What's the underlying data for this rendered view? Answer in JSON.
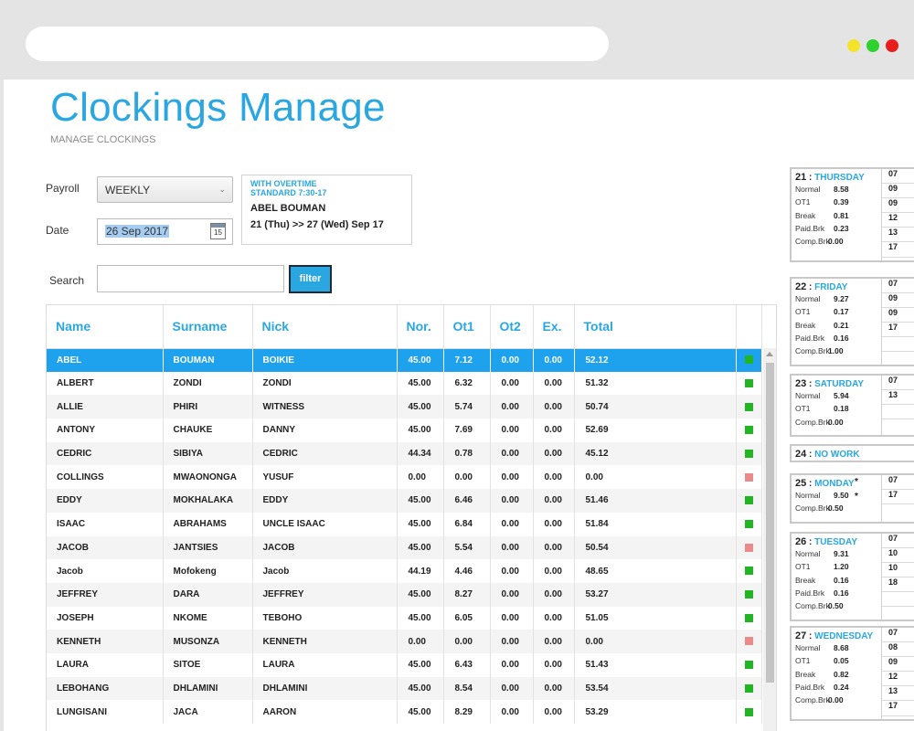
{
  "page": {
    "title": "Clockings Manage",
    "subtitle": "MANAGE CLOCKINGS"
  },
  "filters": {
    "payroll_label": "Payroll",
    "payroll_value": "WEEKLY",
    "date_label": "Date",
    "date_value": "26 Sep 2017",
    "calendar_icon_text": "15",
    "search_label": "Search",
    "search_value": "",
    "filter_button": "filter"
  },
  "info": {
    "line1": "WITH OVERTIME",
    "line2": "STANDARD 7:30-17",
    "employee": "ABEL BOUMAN",
    "period": "21 (Thu) >> 27 (Wed) Sep 17"
  },
  "table": {
    "columns": [
      "Name",
      "Surname",
      "Nick",
      "Nor.",
      "Ot1",
      "Ot2",
      "Ex.",
      "Total"
    ],
    "rows": [
      {
        "name": "ABEL",
        "surname": "BOUMAN",
        "nick": "BOIKIE",
        "nor": "45.00",
        "ot1": "7.12",
        "ot2": "0.00",
        "ex": "0.00",
        "total": "52.12",
        "status": "green"
      },
      {
        "name": "ALBERT",
        "surname": "ZONDI",
        "nick": "ZONDI",
        "nor": "45.00",
        "ot1": "6.32",
        "ot2": "0.00",
        "ex": "0.00",
        "total": "51.32",
        "status": "green"
      },
      {
        "name": "ALLIE",
        "surname": "PHIRI",
        "nick": "WITNESS",
        "nor": "45.00",
        "ot1": "5.74",
        "ot2": "0.00",
        "ex": "0.00",
        "total": "50.74",
        "status": "green"
      },
      {
        "name": "ANTONY",
        "surname": "CHAUKE",
        "nick": "DANNY",
        "nor": "45.00",
        "ot1": "7.69",
        "ot2": "0.00",
        "ex": "0.00",
        "total": "52.69",
        "status": "green"
      },
      {
        "name": "CEDRIC",
        "surname": "SIBIYA",
        "nick": "CEDRIC",
        "nor": "44.34",
        "ot1": "0.78",
        "ot2": "0.00",
        "ex": "0.00",
        "total": "45.12",
        "status": "green"
      },
      {
        "name": "COLLINGS",
        "surname": "MWAONONGA",
        "nick": "YUSUF",
        "nor": "0.00",
        "ot1": "0.00",
        "ot2": "0.00",
        "ex": "0.00",
        "total": "0.00",
        "status": "red"
      },
      {
        "name": "EDDY",
        "surname": "MOKHALAKA",
        "nick": "EDDY",
        "nor": "45.00",
        "ot1": "6.46",
        "ot2": "0.00",
        "ex": "0.00",
        "total": "51.46",
        "status": "green"
      },
      {
        "name": "ISAAC",
        "surname": "ABRAHAMS",
        "nick": "UNCLE ISAAC",
        "nor": "45.00",
        "ot1": "6.84",
        "ot2": "0.00",
        "ex": "0.00",
        "total": "51.84",
        "status": "green"
      },
      {
        "name": "JACOB",
        "surname": "JANTSIES",
        "nick": "JACOB",
        "nor": "45.00",
        "ot1": "5.54",
        "ot2": "0.00",
        "ex": "0.00",
        "total": "50.54",
        "status": "red"
      },
      {
        "name": "Jacob",
        "surname": "Mofokeng",
        "nick": "Jacob",
        "nor": "44.19",
        "ot1": "4.46",
        "ot2": "0.00",
        "ex": "0.00",
        "total": "48.65",
        "status": "green"
      },
      {
        "name": "JEFFREY",
        "surname": "DARA",
        "nick": "JEFFREY",
        "nor": "45.00",
        "ot1": "8.27",
        "ot2": "0.00",
        "ex": "0.00",
        "total": "53.27",
        "status": "green"
      },
      {
        "name": "JOSEPH",
        "surname": "NKOME",
        "nick": "TEBOHO",
        "nor": "45.00",
        "ot1": "6.05",
        "ot2": "0.00",
        "ex": "0.00",
        "total": "51.05",
        "status": "green"
      },
      {
        "name": "KENNETH",
        "surname": "MUSONZA",
        "nick": "KENNETH",
        "nor": "0.00",
        "ot1": "0.00",
        "ot2": "0.00",
        "ex": "0.00",
        "total": "0.00",
        "status": "red"
      },
      {
        "name": "LAURA",
        "surname": "SITOE",
        "nick": "LAURA",
        "nor": "45.00",
        "ot1": "6.43",
        "ot2": "0.00",
        "ex": "0.00",
        "total": "51.43",
        "status": "green"
      },
      {
        "name": "LEBOHANG",
        "surname": "DHLAMINI",
        "nick": "DHLAMINI",
        "nor": "45.00",
        "ot1": "8.54",
        "ot2": "0.00",
        "ex": "0.00",
        "total": "53.54",
        "status": "green"
      },
      {
        "name": "LUNGISANI",
        "surname": "JACA",
        "nick": "AARON",
        "nor": "45.00",
        "ot1": "8.29",
        "ot2": "0.00",
        "ex": "0.00",
        "total": "53.29",
        "status": "green"
      }
    ]
  },
  "days": [
    {
      "num": "21",
      "day": "THURSDAY",
      "stats": [
        {
          "label": "Normal",
          "value": "8.58"
        },
        {
          "label": "OT1",
          "value": "0.39"
        },
        {
          "label": "Break",
          "value": "0.81"
        },
        {
          "label": "Paid.Brk",
          "value": "0.23"
        },
        {
          "label": "Comp.Brk",
          "value": "0.00"
        }
      ],
      "times": [
        {
          "text": "07",
          "star": ""
        },
        {
          "text": "09",
          "star": ""
        },
        {
          "text": "09",
          "star": ""
        },
        {
          "text": "12",
          "star": ""
        },
        {
          "text": "13",
          "star": ""
        },
        {
          "text": "17",
          "star": ""
        }
      ]
    },
    {
      "num": "22",
      "day": "FRIDAY",
      "stats": [
        {
          "label": "Normal",
          "value": "9.27"
        },
        {
          "label": "OT1",
          "value": "0.17"
        },
        {
          "label": "Break",
          "value": "0.21"
        },
        {
          "label": "Paid.Brk",
          "value": "0.16"
        },
        {
          "label": "Comp.Brk",
          "value": "1.00"
        }
      ],
      "times": [
        {
          "text": "07",
          "star": ""
        },
        {
          "text": "09",
          "star": ""
        },
        {
          "text": "09",
          "star": ""
        },
        {
          "text": "17",
          "star": ""
        },
        {
          "text": "",
          "star": ""
        }
      ]
    },
    {
      "num": "23",
      "day": "SATURDAY",
      "stats": [
        {
          "label": "Normal",
          "value": "5.94"
        },
        {
          "label": "OT1",
          "value": "0.18"
        },
        {
          "label": "Comp.Brk",
          "value": "0.00"
        }
      ],
      "times": [
        {
          "text": "07",
          "star": ""
        },
        {
          "text": "13",
          "star": ""
        },
        {
          "text": "",
          "star": ""
        }
      ]
    },
    {
      "num": "24",
      "day": "NO WORK",
      "stats": [],
      "times": []
    },
    {
      "num": "25",
      "day": "MONDAY",
      "stats": [
        {
          "label": "Normal",
          "value": "9.50"
        },
        {
          "label": "Comp.Brk",
          "value": "0.50"
        }
      ],
      "times": [
        {
          "text": "07",
          "star": "*"
        },
        {
          "text": "17",
          "star": "*"
        }
      ]
    },
    {
      "num": "26",
      "day": "TUESDAY",
      "stats": [
        {
          "label": "Normal",
          "value": "9.31"
        },
        {
          "label": "OT1",
          "value": "1.20"
        },
        {
          "label": "Break",
          "value": "0.16"
        },
        {
          "label": "Paid.Brk",
          "value": "0.16"
        },
        {
          "label": "Comp.Brk",
          "value": "0.50"
        }
      ],
      "times": [
        {
          "text": "07",
          "star": ""
        },
        {
          "text": "10",
          "star": ""
        },
        {
          "text": "10",
          "star": ""
        },
        {
          "text": "18",
          "star": ""
        },
        {
          "text": "",
          "star": ""
        }
      ]
    },
    {
      "num": "27",
      "day": "WEDNESDAY",
      "stats": [
        {
          "label": "Normal",
          "value": "8.68"
        },
        {
          "label": "OT1",
          "value": "0.05"
        },
        {
          "label": "Break",
          "value": "0.82"
        },
        {
          "label": "Paid.Brk",
          "value": "0.24"
        },
        {
          "label": "Comp.Brk",
          "value": "0.00"
        }
      ],
      "times": [
        {
          "text": "07",
          "star": ""
        },
        {
          "text": "08",
          "star": ""
        },
        {
          "text": "09",
          "star": ""
        },
        {
          "text": "12",
          "star": ""
        },
        {
          "text": "13",
          "star": ""
        },
        {
          "text": "17",
          "star": ""
        }
      ]
    }
  ],
  "colors": {
    "accent": "#2aa7e0",
    "selected_row": "#1ea2ee",
    "status_green": "#22b523",
    "status_red": "#ea8a8a"
  }
}
